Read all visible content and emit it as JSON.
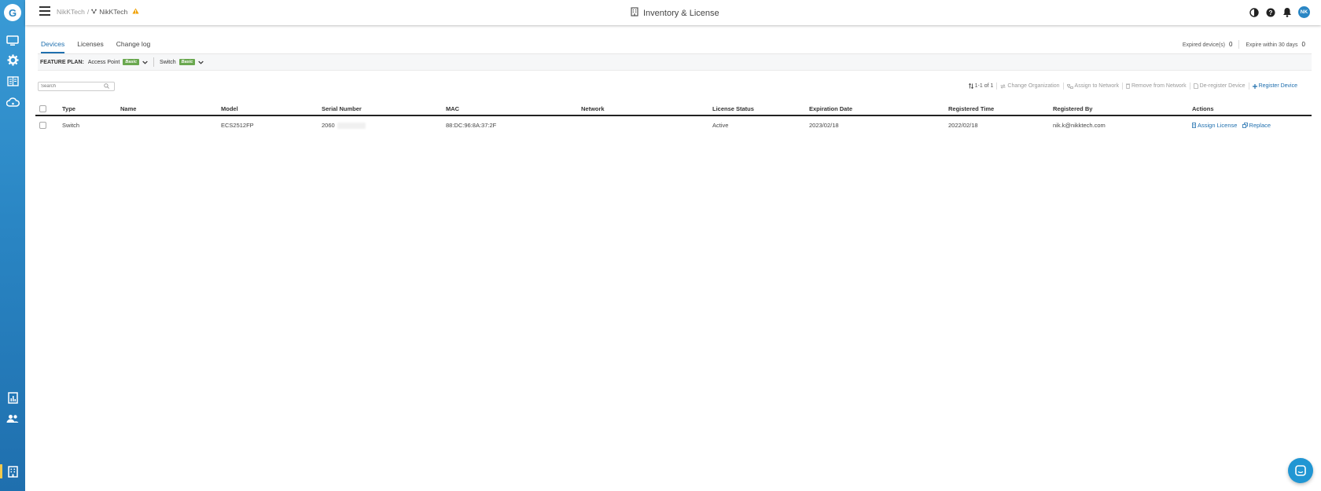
{
  "brand": {
    "logo_letter": "G"
  },
  "header": {
    "breadcrumb_org": "NikKTech",
    "breadcrumb_sep": "/",
    "breadcrumb_site": "NikKTech",
    "title": "Inventory & License",
    "avatar_initials": "NK"
  },
  "sidebar": {
    "items": [
      {
        "name": "monitor"
      },
      {
        "name": "configure"
      },
      {
        "name": "site-wide"
      },
      {
        "name": "cloud"
      },
      {
        "name": "reports"
      },
      {
        "name": "users"
      },
      {
        "name": "inventory"
      }
    ]
  },
  "tabs": [
    {
      "label": "Devices",
      "active": true
    },
    {
      "label": "Licenses",
      "active": false
    },
    {
      "label": "Change log",
      "active": false
    }
  ],
  "expire": {
    "expired_label": "Expired device(s)",
    "expired_count": "0",
    "within_label": "Expire within 30 days",
    "within_count": "0"
  },
  "feature_plan": {
    "label": "FEATURE PLAN:",
    "ap_label": "Access Point",
    "ap_badge": "Basic",
    "switch_label": "Switch",
    "switch_badge": "Basic"
  },
  "search": {
    "placeholder": "Search"
  },
  "toolbar": {
    "count": "1-1 of 1",
    "change_org": "Change Organization",
    "assign_network": "Assign to Network",
    "remove_network": "Remove from Network",
    "deregister": "De-register Device",
    "register": "Register Device"
  },
  "table": {
    "columns": [
      "Type",
      "Name",
      "Model",
      "Serial Number",
      "MAC",
      "Network",
      "License Status",
      "Expiration Date",
      "Registered Time",
      "Registered By",
      "Actions"
    ],
    "rows": [
      {
        "type": "Switch",
        "name": "",
        "model": "ECS2512FP",
        "serial": "2060",
        "mac": "88:DC:96:8A:37:2F",
        "network": "",
        "license_status": "Active",
        "expiration": "2023/02/18",
        "registered_time": "2022/02/18",
        "registered_by": "nik.k@nikktech.com",
        "action_assign": "Assign License",
        "action_replace": "Replace"
      }
    ]
  },
  "colors": {
    "accent": "#1f6fae",
    "sidebar": "#2a86c4",
    "badge": "#6aa84f",
    "warning": "#f0a000"
  }
}
